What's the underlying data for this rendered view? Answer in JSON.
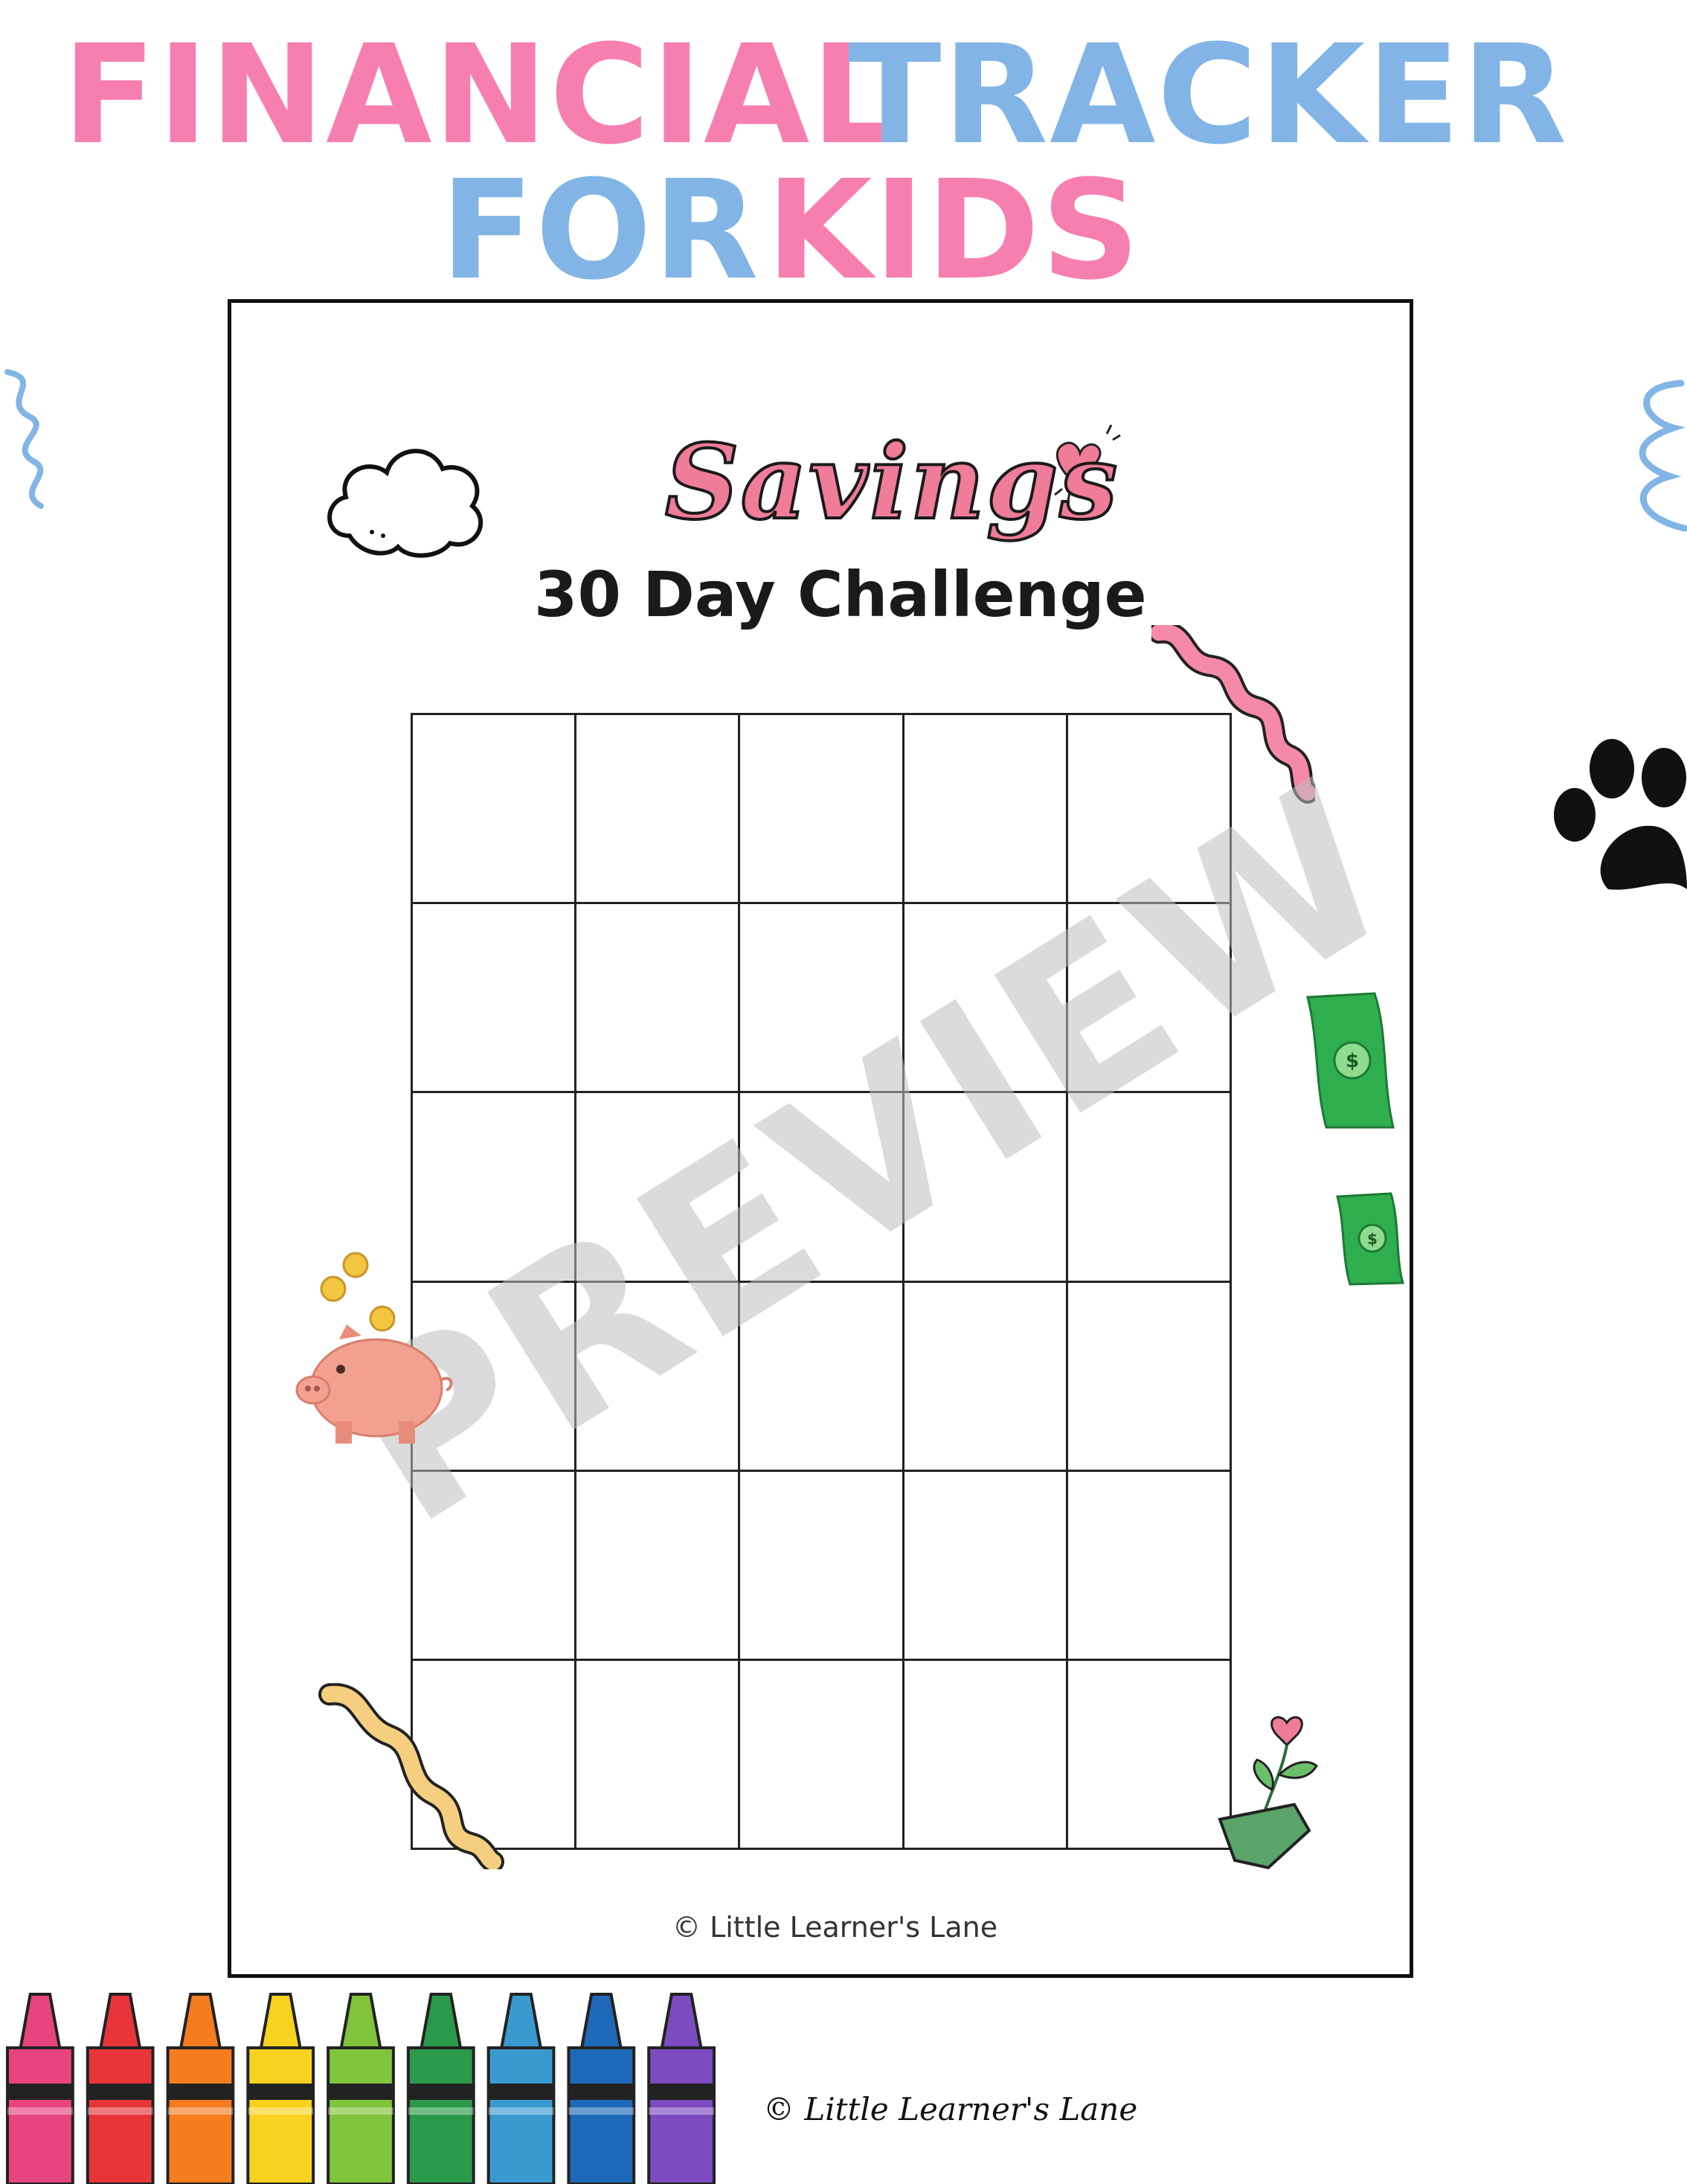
{
  "header": {
    "line1_part1": "FINANCIAL",
    "line1_part2": "TRACKER",
    "line2_part1": "FOR",
    "line2_part2": "KIDS"
  },
  "worksheet": {
    "title_script": "Savings",
    "title_main": "30 Day Challenge",
    "grid": {
      "columns": 5,
      "rows": 6
    },
    "watermark": "PREVIEW",
    "footer": "© Little Learner's Lane"
  },
  "page_footer": "© Little Learner's Lane",
  "colors": {
    "pink": "#f77fb0",
    "blue": "#82b5e6",
    "crayons": [
      "#e8447f",
      "#e8353a",
      "#f57c1f",
      "#f7d31f",
      "#7fc43a",
      "#2a9a4a",
      "#3a9ad0",
      "#1f6ab8",
      "#7b4bbf"
    ]
  },
  "icons": [
    "cloud-icon",
    "heart-icon",
    "pink-squiggle",
    "paw-print-icon",
    "money-bill-icon",
    "piggy-bank-icon",
    "yellow-squiggle",
    "flower-pot-icon",
    "blue-squiggle",
    "crayons"
  ]
}
